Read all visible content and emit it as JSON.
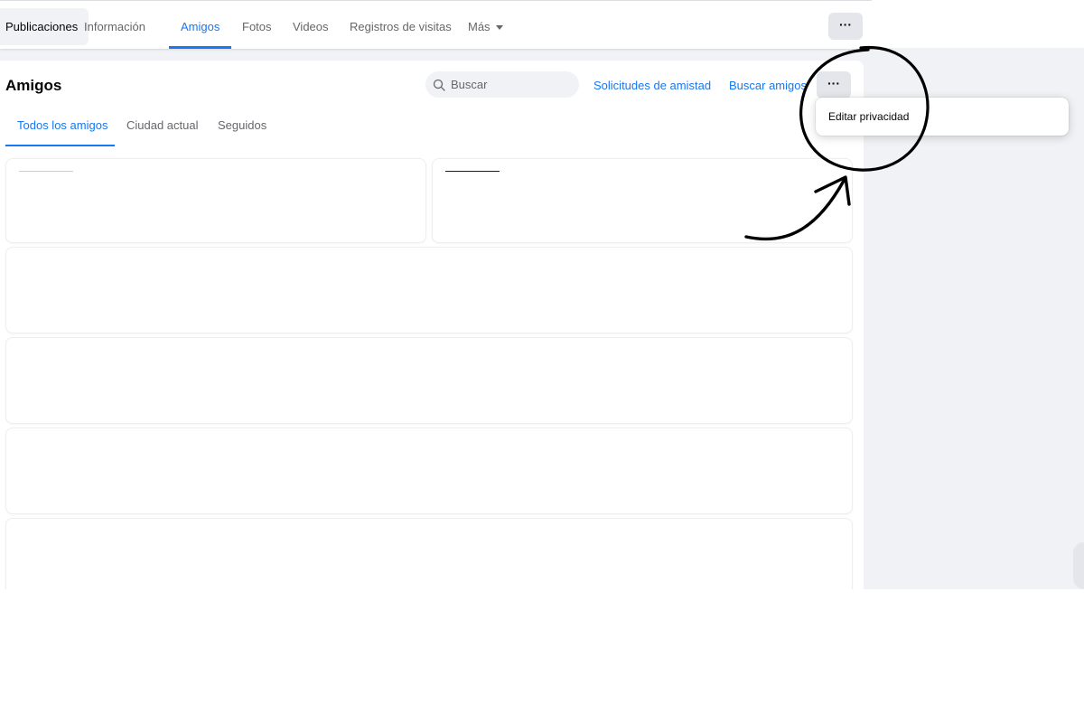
{
  "nav": {
    "tabs": [
      {
        "label": "Publicaciones"
      },
      {
        "label": "Información"
      },
      {
        "label": "Amigos"
      },
      {
        "label": "Fotos"
      },
      {
        "label": "Videos"
      },
      {
        "label": "Registros de visitas"
      },
      {
        "label": "Más"
      }
    ],
    "more_menu_label": "···"
  },
  "friends": {
    "title": "Amigos",
    "search_placeholder": "Buscar",
    "friend_requests_label": "Solicitudes de amistad",
    "find_friends_label": "Buscar amigos",
    "options_label": "···",
    "sub_tabs": [
      {
        "label": "Todos los amigos"
      },
      {
        "label": "Ciudad actual"
      },
      {
        "label": "Seguidos"
      }
    ]
  },
  "dropdown": {
    "items": [
      {
        "label": "Editar privacidad"
      }
    ]
  },
  "colors": {
    "accent": "#1877f2",
    "annotation": "#000000"
  }
}
